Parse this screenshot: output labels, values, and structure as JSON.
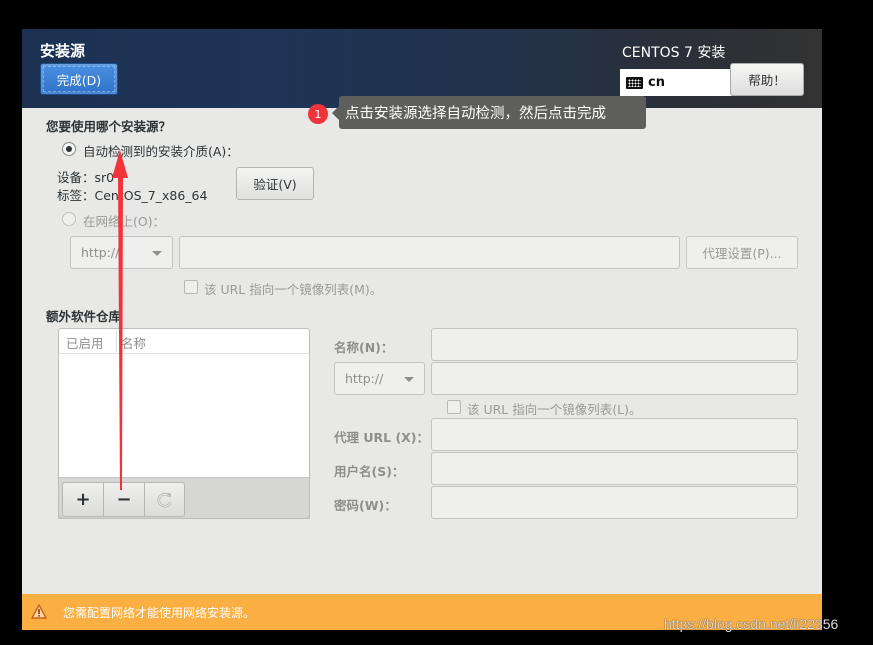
{
  "header": {
    "spoke_title": "安装源",
    "done_button": "完成(D)",
    "product_title": "CENTOS 7 安装",
    "keyboard_layout": "cn",
    "help_button": "帮助！"
  },
  "source": {
    "question": "您要使用哪个安装源？",
    "auto_detected": {
      "label": "自动检测到的安装介质(A)：",
      "selected": true,
      "device_label": "设备：sr0",
      "tag_label": "标签：CentOS_7_x86_64",
      "verify_button": "验证(V)"
    },
    "network": {
      "label": "在网络上(O)：",
      "selected": false,
      "protocol": "http://",
      "url_value": "",
      "proxy_button": "代理设置(P)...",
      "mirror_checkbox": "该 URL 指向一个镜像列表(M)。",
      "mirror_checked": false
    }
  },
  "repos": {
    "title": "额外软件仓库",
    "columns": [
      "已启用",
      "名称"
    ],
    "rows": [],
    "toolbar": {
      "add": "+",
      "remove": "−",
      "refresh": "refresh-icon"
    },
    "form": {
      "name_label": "名称(N)：",
      "name_value": "",
      "protocol": "http://",
      "url_value": "",
      "mirror_checkbox": "该 URL 指向一个镜像列表(L)。",
      "mirror_checked": false,
      "proxy_url_label": "代理 URL (X)：",
      "username_label": "用户名(S)：",
      "password_label": "密码(W)："
    }
  },
  "info_bar": {
    "icon": "warning-icon",
    "message": "您需配置网络才能使用网络安装源。",
    "color": "#fbae41"
  },
  "annotation": {
    "badge": "1",
    "text": "点击安装源选择自动检测，然后点击完成",
    "badge_color": "#f1343c",
    "arrow_color": "#f1343c"
  },
  "watermark": "https://blog.csdn.net/li22356"
}
